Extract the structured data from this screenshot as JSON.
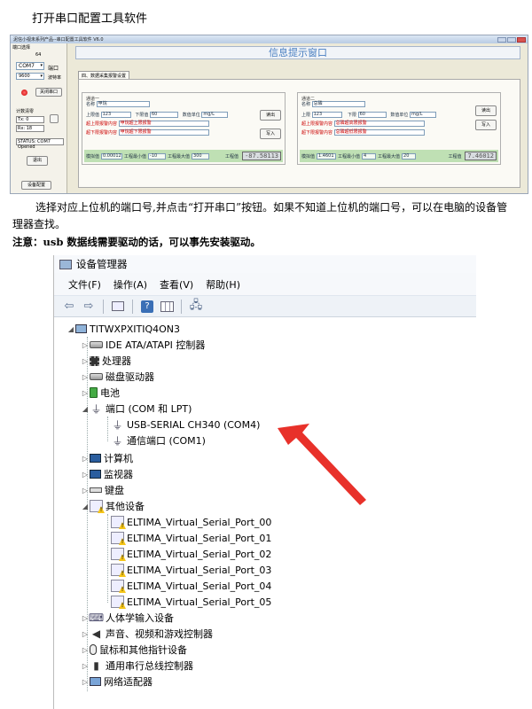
{
  "doc": {
    "title": "打开串口配置工具软件",
    "paragraph": "选择对应上位机的端口号,并点击“打开串口”按钮。如果不知道上位机的端口号，可以在电脑的设备管理器查找。",
    "note": "注意：usb 数据线需要驱动的话，可以事先安装驱动。"
  },
  "tool": {
    "window_title": "泥信小视未系列产品--串口配置工具软件  V6.0",
    "left": {
      "section_label": "端口选择",
      "section_sub": "64",
      "com_value": "COM7",
      "com_label": "端口",
      "baud_value": "9600",
      "baud_label": "波特率",
      "open_btn": "关闭串口",
      "count_label": "计数清零",
      "tx": "Tx: 0",
      "rx": "Rx: 18",
      "status": "STATUS: COM7 Opened",
      "exit_btn": "退出",
      "settings_btn": "设备配置"
    },
    "info_window": "信息提示窗口",
    "tab": "四、数据采集报警设置",
    "panel1": {
      "group": "通道一",
      "name_label": "名称",
      "name_value": "甲烷",
      "upper_label": "上限值",
      "upper_value": "123",
      "lower_label": "下限值",
      "lower_value": "60",
      "unit_label": "数值单位",
      "unit_value": "mg/L",
      "over_upper_label": "超上限报警内容",
      "over_upper_value": "甲烷超上限报警",
      "over_lower_label": "超下限报警内容",
      "over_lower_value": "甲烷超下限报警",
      "read_btn": "读出",
      "write_btn": "写入",
      "analog_label": "模拟值",
      "analog_value": "0.00012",
      "min_label": "工程最小值",
      "min_value": "-10",
      "max_label": "工程最大值",
      "max_value": "300",
      "eng_label": "工程值",
      "eng_value": "-87.58113"
    },
    "panel2": {
      "group": "通道二",
      "name_label": "名称",
      "name_value": "总磷",
      "upper_label": "上限",
      "upper_value": "123",
      "lower_label": "下限",
      "lower_value": "60",
      "unit_label": "数值单位",
      "unit_value": "mg/L",
      "over_upper_label": "超上限报警内容",
      "over_upper_value": "总磷超高限报警",
      "over_lower_label": "超下限报警内容",
      "over_lower_value": "总磷超低限报警",
      "read_btn": "读出",
      "write_btn": "写入",
      "analog_label": "模拟值",
      "analog_value": "1.4601",
      "min_label": "工程最小值",
      "min_value": "4",
      "max_label": "工程最大值",
      "max_value": "20",
      "eng_label": "工程值",
      "eng_value": "7.46012"
    }
  },
  "devmgr": {
    "title": "设备管理器",
    "menu": [
      "文件(F)",
      "操作(A)",
      "查看(V)",
      "帮助(H)"
    ],
    "root": "TITWXPXITIQ4ON3",
    "nodes": [
      "IDE ATA/ATAPI 控制器",
      "处理器",
      "磁盘驱动器",
      "电池",
      "端口 (COM 和 LPT)",
      "USB-SERIAL CH340 (COM4)",
      "通信端口 (COM1)",
      "计算机",
      "监视器",
      "键盘",
      "其他设备",
      "ELTIMA_Virtual_Serial_Port_00",
      "ELTIMA_Virtual_Serial_Port_01",
      "ELTIMA_Virtual_Serial_Port_02",
      "ELTIMA_Virtual_Serial_Port_03",
      "ELTIMA_Virtual_Serial_Port_04",
      "ELTIMA_Virtual_Serial_Port_05",
      "人体学输入设备",
      "声音、视频和游戏控制器",
      "鼠标和其他指针设备",
      "通用串行总线控制器",
      "网络适配器"
    ],
    "arrow_color": "#e8312a"
  }
}
